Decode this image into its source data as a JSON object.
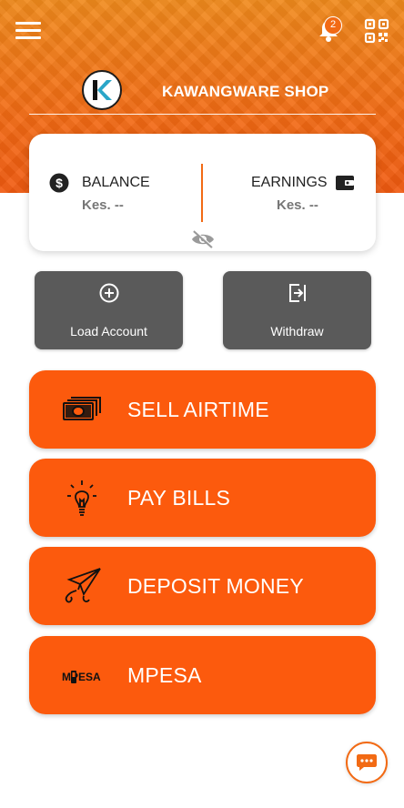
{
  "header": {
    "shop_name": "KAWANGWARE SHOP",
    "notification_count": "2",
    "logo_letter": "K"
  },
  "balance_card": {
    "balance_label": "BALANCE",
    "balance_value": "Kes. --",
    "earnings_label": "EARNINGS",
    "earnings_value": "Kes. --"
  },
  "actions": {
    "load_label": "Load Account",
    "withdraw_label": "Withdraw"
  },
  "services": [
    {
      "label": "SELL AIRTIME",
      "icon": "cash-icon"
    },
    {
      "label": "PAY BILLS",
      "icon": "lightbulb-icon"
    },
    {
      "label": "DEPOSIT MONEY",
      "icon": "paper-plane-icon"
    },
    {
      "label": "MPESA",
      "icon": "mpesa-icon",
      "icon_text": "MPESA"
    }
  ],
  "colors": {
    "accent": "#fc5a0d",
    "header": "#f26a14",
    "action_button": "#5a5a5a"
  }
}
